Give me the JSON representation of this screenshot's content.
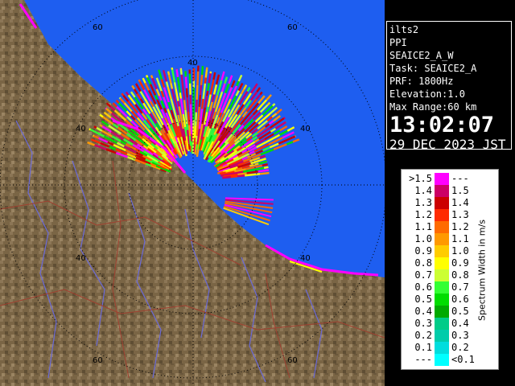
{
  "radar": {
    "range_ring_labels": [
      "60",
      "60",
      "40",
      "40",
      "40",
      "40",
      "40",
      "60",
      "60"
    ],
    "colors": {
      "sea": "#1e5ef0",
      "land": "#7a6545",
      "rings": "#000000"
    }
  },
  "info": {
    "site": "ilts2",
    "mode": "PPI",
    "product": "SEAICE2_A_W",
    "task": "Task: SEAICE2_A",
    "prf": "PRF: 1800Hz",
    "elevation": "Elevation:1.0",
    "max_range": "Max Range:60 km",
    "time": "13:02:07",
    "date": "29 DEC 2023 JST"
  },
  "legend": {
    "unit_label": "Spectrum Width in m/s",
    "rows": [
      {
        "lo": ">1.5",
        "hi": "---",
        "color": "#ff00ff"
      },
      {
        "lo": "1.4",
        "hi": "1.5",
        "color": "#cc0066"
      },
      {
        "lo": "1.3",
        "hi": "1.4",
        "color": "#cc0000"
      },
      {
        "lo": "1.2",
        "hi": "1.3",
        "color": "#ff2a00"
      },
      {
        "lo": "1.1",
        "hi": "1.2",
        "color": "#ff6a00"
      },
      {
        "lo": "1.0",
        "hi": "1.1",
        "color": "#ff9900"
      },
      {
        "lo": "0.9",
        "hi": "1.0",
        "color": "#ffcc00"
      },
      {
        "lo": "0.8",
        "hi": "0.9",
        "color": "#ffff00"
      },
      {
        "lo": "0.7",
        "hi": "0.8",
        "color": "#ccff33"
      },
      {
        "lo": "0.6",
        "hi": "0.7",
        "color": "#33ff33"
      },
      {
        "lo": "0.5",
        "hi": "0.6",
        "color": "#00dd00"
      },
      {
        "lo": "0.4",
        "hi": "0.5",
        "color": "#00aa00"
      },
      {
        "lo": "0.3",
        "hi": "0.4",
        "color": "#00cc88"
      },
      {
        "lo": "0.2",
        "hi": "0.3",
        "color": "#00ccaa"
      },
      {
        "lo": "0.1",
        "hi": "0.2",
        "color": "#00dddd"
      },
      {
        "lo": "---",
        "hi": "<0.1",
        "color": "#00ffff"
      }
    ]
  }
}
